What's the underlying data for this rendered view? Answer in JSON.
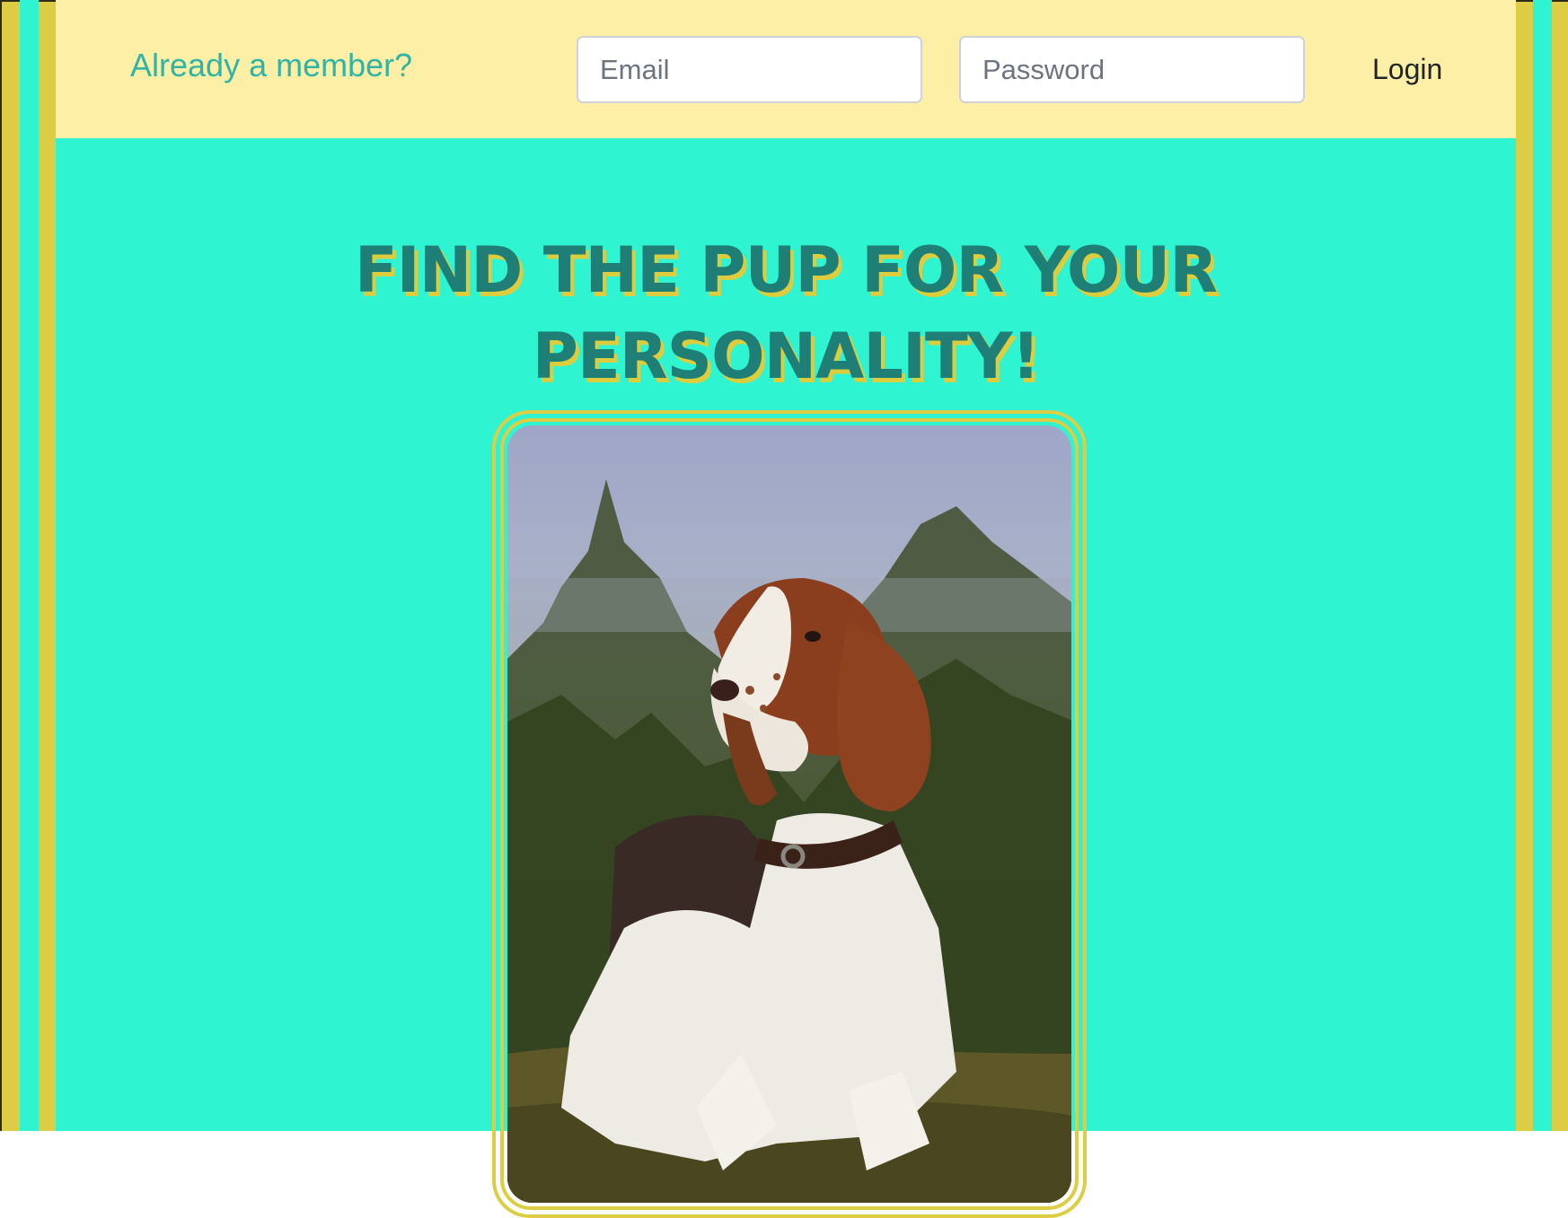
{
  "header": {
    "member_prompt": "Already a member?",
    "email_placeholder": "Email",
    "password_placeholder": "Password",
    "login_label": "Login"
  },
  "hero": {
    "heading_line1": "FIND THE PUP FOR YOUR",
    "heading_line2": "PERSONALITY!",
    "image_alt": "Welsh springer spaniel dog sitting in grass in front of a conifer tree"
  },
  "colors": {
    "frame_yellow": "#ddcd44",
    "teal_background": "#2ff4d1",
    "header_background": "#fdefa5",
    "member_text": "#2fb4a6",
    "heading_text": "#1f7f76",
    "heading_shadow": "#dccd3e"
  }
}
